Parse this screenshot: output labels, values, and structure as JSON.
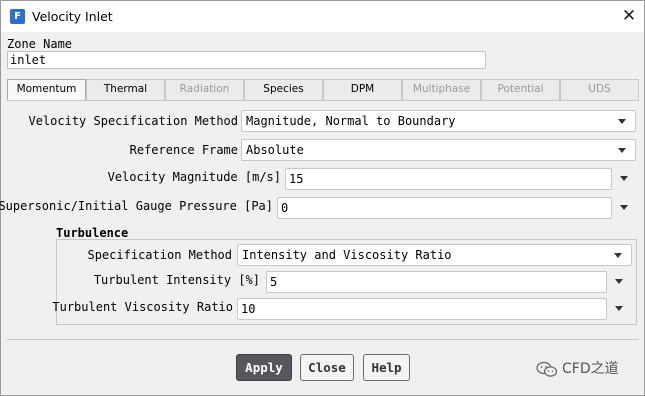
{
  "window": {
    "title": "Velocity Inlet",
    "app_icon": "F"
  },
  "zone": {
    "label": "Zone Name",
    "value": "inlet"
  },
  "tabs": [
    {
      "label": "Momentum",
      "active": true,
      "enabled": true
    },
    {
      "label": "Thermal",
      "active": false,
      "enabled": true
    },
    {
      "label": "Radiation",
      "active": false,
      "enabled": false
    },
    {
      "label": "Species",
      "active": false,
      "enabled": true
    },
    {
      "label": "DPM",
      "active": false,
      "enabled": true
    },
    {
      "label": "Multiphase",
      "active": false,
      "enabled": false
    },
    {
      "label": "Potential",
      "active": false,
      "enabled": false
    },
    {
      "label": "UDS",
      "active": false,
      "enabled": false
    }
  ],
  "momentum": {
    "velocity_spec_method": {
      "label": "Velocity Specification Method",
      "value": "Magnitude, Normal to Boundary"
    },
    "reference_frame": {
      "label": "Reference Frame",
      "value": "Absolute"
    },
    "velocity_magnitude": {
      "label": "Velocity Magnitude [m/s]",
      "value": "15"
    },
    "gauge_pressure": {
      "label": "Supersonic/Initial Gauge Pressure [Pa]",
      "value": "0"
    }
  },
  "turbulence": {
    "title": "Turbulence",
    "spec_method": {
      "label": "Specification Method",
      "value": "Intensity and Viscosity Ratio"
    },
    "intensity": {
      "label": "Turbulent Intensity [%]",
      "value": "5"
    },
    "viscosity_ratio": {
      "label": "Turbulent Viscosity Ratio",
      "value": "10"
    }
  },
  "buttons": {
    "apply": "Apply",
    "close": "Close",
    "help": "Help"
  },
  "watermark": {
    "text": "CFD之道",
    "icon": "wechat-icon"
  },
  "colors": {
    "primary_button": "#55575c",
    "app_icon": "#2f6fd1"
  }
}
